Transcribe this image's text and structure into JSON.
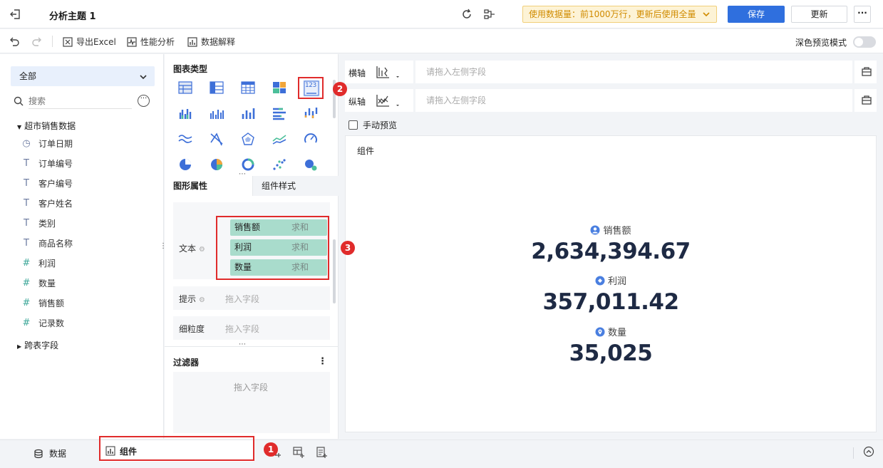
{
  "header": {
    "title": "分析主题 1",
    "data_usage": "使用数据量：前1000万行，更新后使用全量",
    "save_label": "保存",
    "update_label": "更新",
    "more_label": "···"
  },
  "toolbar": {
    "export_excel": "导出Excel",
    "perf_analysis": "性能分析",
    "data_explain": "数据解释",
    "dark_preview": "深色预览模式"
  },
  "left": {
    "scope": "全部",
    "search_placeholder": "搜索",
    "dataset_name": "超市销售数据",
    "fields": [
      {
        "name": "订单日期",
        "type": "date",
        "icon": "clock-icon"
      },
      {
        "name": "订单编号",
        "type": "text",
        "icon": "text-T-icon"
      },
      {
        "name": "客户编号",
        "type": "text",
        "icon": "text-T-icon"
      },
      {
        "name": "客户姓名",
        "type": "text",
        "icon": "text-T-icon"
      },
      {
        "name": "类别",
        "type": "text",
        "icon": "text-T-icon"
      },
      {
        "name": "商品名称",
        "type": "text",
        "icon": "text-T-icon"
      },
      {
        "name": "利润",
        "type": "number",
        "icon": "hash-icon"
      },
      {
        "name": "数量",
        "type": "number",
        "icon": "hash-icon"
      },
      {
        "name": "销售额",
        "type": "number",
        "icon": "hash-icon"
      },
      {
        "name": "记录数",
        "type": "number",
        "icon": "hash-icon"
      }
    ],
    "cross_table": "跨表字段"
  },
  "middle": {
    "chart_type_label": "图表类型",
    "chart_type_selected_text": "123",
    "tab_props": "图形属性",
    "tab_style": "组件样式",
    "text_label": "文本",
    "text_fields": [
      {
        "name": "销售额",
        "agg": "求和"
      },
      {
        "name": "利润",
        "agg": "求和"
      },
      {
        "name": "数量",
        "agg": "求和"
      }
    ],
    "tip_label": "提示",
    "granularity_label": "细粒度",
    "drag_field": "拖入字段",
    "filter_label": "过滤器",
    "filter_hint": "拖入字段"
  },
  "axes": {
    "x_label": "横轴",
    "y_label": "纵轴",
    "drop_hint": "请拖入左侧字段",
    "manual_preview": "手动预览"
  },
  "canvas": {
    "title": "组件",
    "kpis": [
      {
        "label": "销售额",
        "value": "2,634,394.67",
        "icon": "person-circle-icon"
      },
      {
        "label": "利润",
        "value": "357,011.42",
        "icon": "diamond-circle-icon"
      },
      {
        "label": "数量",
        "value": "35,025",
        "icon": "location-pin-icon"
      }
    ]
  },
  "bottom": {
    "data_tab": "数据",
    "widget_tab": "组件"
  },
  "annotations": {
    "m1": "1",
    "m2": "2",
    "m3": "3"
  },
  "colors": {
    "primary": "#2f6fde",
    "pill": "#a9dccc",
    "annotation": "#e02b2b",
    "kpi_value": "#1e2a44"
  }
}
